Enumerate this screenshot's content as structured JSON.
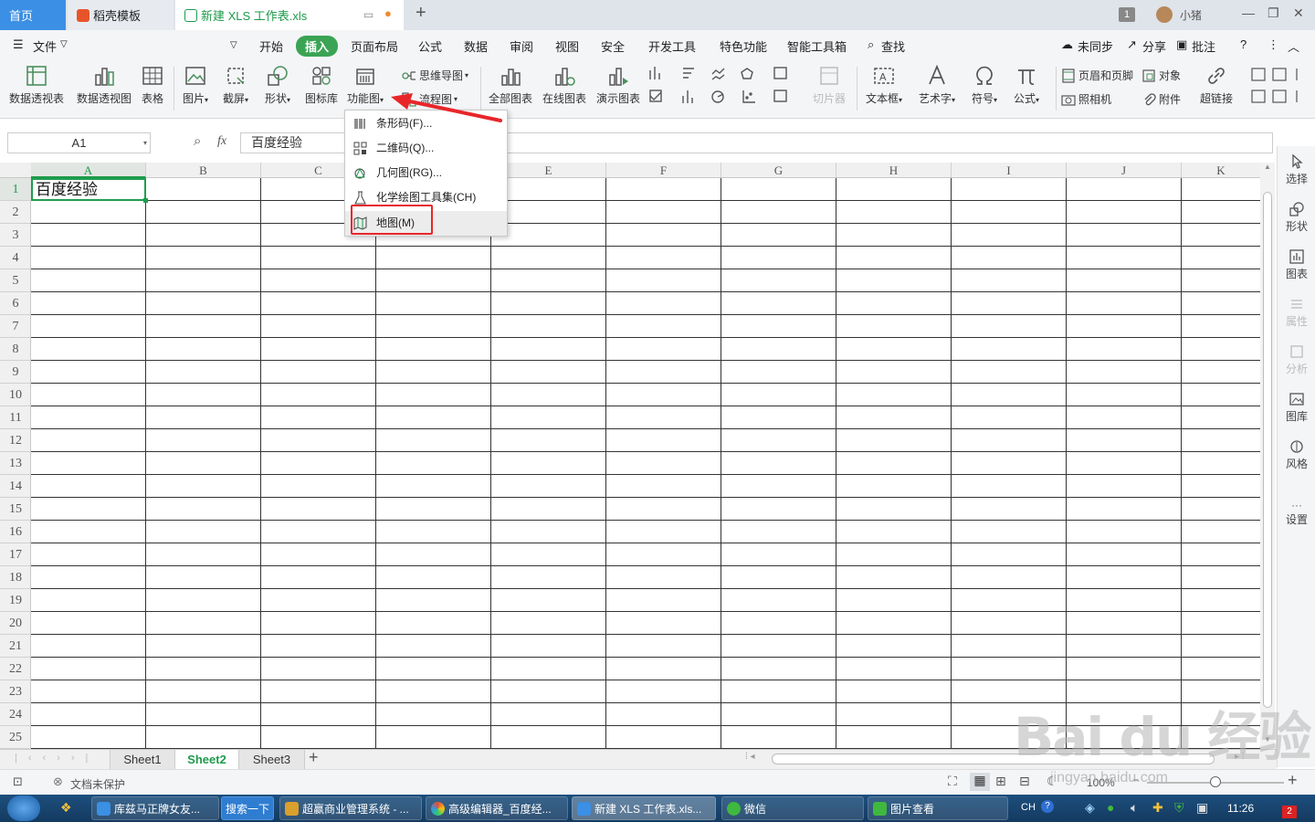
{
  "tabs": {
    "home": "首页",
    "template": "稻壳模板",
    "document": "新建 XLS 工作表.xls",
    "count_badge": "1",
    "user": "小猪"
  },
  "menu": {
    "file": "文件",
    "items": [
      "开始",
      "插入",
      "页面布局",
      "公式",
      "数据",
      "审阅",
      "视图",
      "安全",
      "开发工具",
      "特色功能",
      "智能工具箱"
    ],
    "search": "查找",
    "sync": "未同步",
    "share": "分享",
    "comment": "批注"
  },
  "ribbon": {
    "pivot_table": "数据透视表",
    "pivot_chart": "数据透视图",
    "table": "表格",
    "picture": "图片",
    "screenshot": "截屏",
    "shape": "形状",
    "icon_lib": "图标库",
    "function_chart": "功能图",
    "mind_map": "思维导图",
    "flow_chart": "流程图",
    "all_charts": "全部图表",
    "online_chart": "在线图表",
    "demo_chart": "演示图表",
    "slicer": "切片器",
    "textbox": "文本框",
    "wordart": "艺术字",
    "symbol": "符号",
    "formula": "公式",
    "header_footer": "页眉和页脚",
    "object": "对象",
    "camera": "照相机",
    "attachment": "附件",
    "hyperlink": "超链接"
  },
  "formula_bar": {
    "cell_ref": "A1",
    "fx": "fx",
    "content": "百度经验"
  },
  "columns": [
    "A",
    "B",
    "C",
    "D",
    "E",
    "F",
    "G",
    "H",
    "I",
    "J",
    "K"
  ],
  "rows": [
    "1",
    "2",
    "3",
    "4",
    "5",
    "6",
    "7",
    "8",
    "9",
    "10",
    "11",
    "12",
    "13",
    "14",
    "15",
    "16",
    "17",
    "18",
    "19",
    "20",
    "21",
    "22",
    "23",
    "24",
    "25"
  ],
  "cell_a1": "百度经验",
  "dropdown": {
    "items": [
      {
        "label": "条形码(F)..."
      },
      {
        "label": "二维码(Q)..."
      },
      {
        "label": "几何图(RG)..."
      },
      {
        "label": "化学绘图工具集(CH)"
      },
      {
        "label": "地图(M)"
      }
    ]
  },
  "right_panel": [
    "选择",
    "形状",
    "图表",
    "属性",
    "分析",
    "图库",
    "风格",
    "设置"
  ],
  "sheets": [
    "Sheet1",
    "Sheet2",
    "Sheet3"
  ],
  "status": {
    "protect": "文档未保护",
    "zoom": "100%"
  },
  "taskbar": {
    "items": [
      "库兹马正牌女友...",
      "搜索一下",
      "超赢商业管理系统 - ...",
      "高级编辑器_百度经...",
      "新建 XLS 工作表.xls...",
      "微信",
      "图片查看"
    ],
    "lang": "CH",
    "time": "11:26",
    "badge": "2"
  },
  "watermark": {
    "main": "Bai du 经验",
    "sub": "jingyan.baidu.com"
  },
  "colors": {
    "accent_green": "#1d9b4b",
    "highlight_red": "#e8262a",
    "taskbar": "#1d4f7e"
  }
}
